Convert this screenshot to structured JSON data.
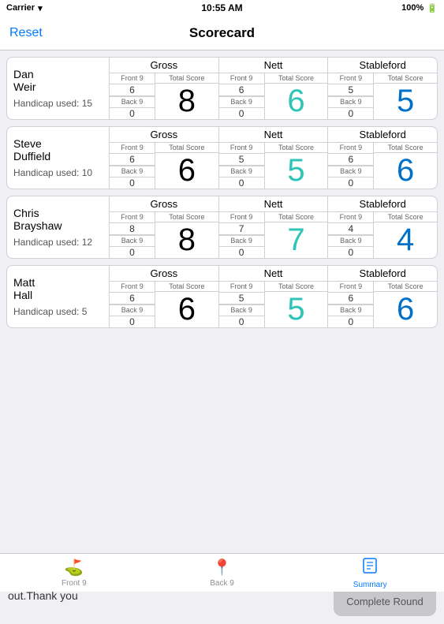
{
  "statusBar": {
    "carrier": "Carrier",
    "time": "10:55 AM",
    "battery": "100%"
  },
  "navBar": {
    "title": "Scorecard",
    "resetLabel": "Reset"
  },
  "players": [
    {
      "firstName": "Dan",
      "lastName": "Weir",
      "handicap": "Handicap used: 15",
      "gross": {
        "header": "Gross",
        "frontLabel": "Front 9",
        "frontValue": "6",
        "backLabel": "Back 9",
        "backValue": "0",
        "totalHeader": "Total Score",
        "totalValue": "8",
        "totalColor": "black"
      },
      "nett": {
        "header": "Nett",
        "frontLabel": "Front 9",
        "frontValue": "6",
        "backLabel": "Back 9",
        "backValue": "0",
        "totalHeader": "Total Score",
        "totalValue": "6",
        "totalColor": "teal"
      },
      "stableford": {
        "header": "Stableford",
        "frontLabel": "Front 9",
        "frontValue": "5",
        "backLabel": "Back 9",
        "backValue": "0",
        "totalHeader": "Total Score",
        "totalValue": "5",
        "totalColor": "blue"
      }
    },
    {
      "firstName": "Steve",
      "lastName": "Duffield",
      "handicap": "Handicap used: 10",
      "gross": {
        "header": "Gross",
        "frontLabel": "Front 9",
        "frontValue": "6",
        "backLabel": "Back 9",
        "backValue": "0",
        "totalHeader": "Total Score",
        "totalValue": "6",
        "totalColor": "black"
      },
      "nett": {
        "header": "Nett",
        "frontLabel": "Front 9",
        "frontValue": "5",
        "backLabel": "Back 9",
        "backValue": "0",
        "totalHeader": "Total Score",
        "totalValue": "5",
        "totalColor": "teal"
      },
      "stableford": {
        "header": "Stableford",
        "frontLabel": "Front 9",
        "frontValue": "6",
        "backLabel": "Back 9",
        "backValue": "0",
        "totalHeader": "Total Score",
        "totalValue": "6",
        "totalColor": "blue"
      }
    },
    {
      "firstName": "Chris",
      "lastName": "Brayshaw",
      "handicap": "Handicap used: 12",
      "gross": {
        "header": "Gross",
        "frontLabel": "Front 9",
        "frontValue": "8",
        "backLabel": "Back 9",
        "backValue": "0",
        "totalHeader": "Total Score",
        "totalValue": "8",
        "totalColor": "black"
      },
      "nett": {
        "header": "Nett",
        "frontLabel": "Front 9",
        "frontValue": "7",
        "backLabel": "Back 9",
        "backValue": "0",
        "totalHeader": "Total Score",
        "totalValue": "7",
        "totalColor": "teal"
      },
      "stableford": {
        "header": "Stableford",
        "frontLabel": "Front 9",
        "frontValue": "4",
        "backLabel": "Back 9",
        "backValue": "0",
        "totalHeader": "Total Score",
        "totalValue": "4",
        "totalColor": "blue"
      }
    },
    {
      "firstName": "Matt",
      "lastName": "Hall",
      "handicap": "Handicap used: 5",
      "gross": {
        "header": "Gross",
        "frontLabel": "Front 9",
        "frontValue": "6",
        "backLabel": "Back 9",
        "backValue": "0",
        "totalHeader": "Total Score",
        "totalValue": "6",
        "totalColor": "black"
      },
      "nett": {
        "header": "Nett",
        "frontLabel": "Front 9",
        "frontValue": "5",
        "backLabel": "Back 9",
        "backValue": "0",
        "totalHeader": "Total Score",
        "totalValue": "5",
        "totalColor": "teal"
      },
      "stableford": {
        "header": "Stableford",
        "frontLabel": "Front 9",
        "frontValue": "6",
        "backLabel": "Back 9",
        "backValue": "0",
        "totalHeader": "Total Score",
        "totalValue": "6",
        "totalColor": "blue"
      }
    }
  ],
  "bottomText": "Please press the complete round button to submit score and log out.Thank you",
  "completeRoundLabel": "Complete Round",
  "tabs": [
    {
      "label": "Front 9",
      "icon": "🚩",
      "active": false
    },
    {
      "label": "Back 9",
      "icon": "📍",
      "active": false
    },
    {
      "label": "Summary",
      "icon": "📋",
      "active": true
    }
  ]
}
